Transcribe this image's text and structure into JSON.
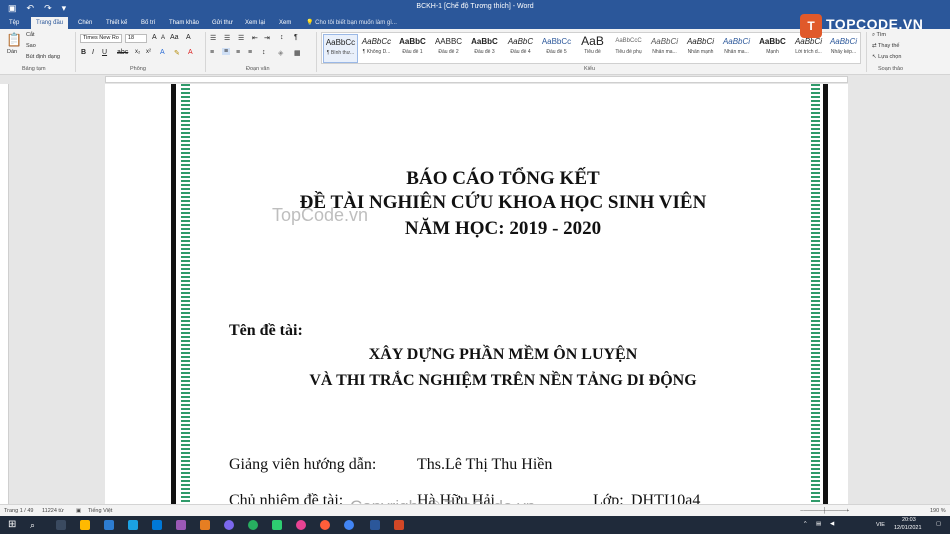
{
  "window": {
    "title": "BCKH-1 [Chế độ Tương thích] - Word"
  },
  "qat": {
    "undo": "↶",
    "redo": "↷",
    "customize": "▾"
  },
  "tabs": [
    {
      "label": "Tệp"
    },
    {
      "label": "Trang đầu"
    },
    {
      "label": "Chèn"
    },
    {
      "label": "Thiết kế"
    },
    {
      "label": "Bố trí"
    },
    {
      "label": "Tham khảo"
    },
    {
      "label": "Gửi thư"
    },
    {
      "label": "Xem lại"
    },
    {
      "label": "Xem"
    }
  ],
  "tell_me": "Cho tôi biết bạn muốn làm gì...",
  "ribbon": {
    "clipboard": {
      "paste": "Dán",
      "cut": "Cắt",
      "copy": "Sao",
      "format_painter": "Bút định dạng",
      "label": "Bảng tạm"
    },
    "font": {
      "name": "Times New Ro",
      "size": "18",
      "label": "Phông"
    },
    "paragraph": {
      "label": "Đoạn văn"
    },
    "styles_label": "Kiểu",
    "editing": {
      "find": "Tìm",
      "replace": "Thay thế",
      "select": "Lựa chọn",
      "label": "Soạn thảo"
    }
  },
  "styles": [
    {
      "preview": "AaBbCc",
      "name": "¶ Bình thư..."
    },
    {
      "preview": "AaBbCc",
      "name": "¶ Không D..."
    },
    {
      "preview": "AaBbC",
      "name": "Đầu đề 1"
    },
    {
      "preview": "AABBC",
      "name": "Đầu đề 2"
    },
    {
      "preview": "AaBbC",
      "name": "Đầu đề 3"
    },
    {
      "preview": "AaBbC",
      "name": "Đầu đề 4"
    },
    {
      "preview": "AaBbCc",
      "name": "Đầu đề 5"
    },
    {
      "preview": "AaB",
      "name": "Tiêu đề"
    },
    {
      "preview": "AaBbCcC",
      "name": "Tiêu đề phụ"
    },
    {
      "preview": "AaBbCi",
      "name": "Nhấn ma..."
    },
    {
      "preview": "AaBbCi",
      "name": "Nhấn mạnh"
    },
    {
      "preview": "AaBbCi",
      "name": "Nhấn ma..."
    },
    {
      "preview": "AaBbC",
      "name": "Mạnh"
    },
    {
      "preview": "AaBbCi",
      "name": "Lời trích d..."
    },
    {
      "preview": "AaBbCi",
      "name": "Nhấy kép..."
    }
  ],
  "document": {
    "title1": "BÁO CÁO TỔNG KẾT",
    "title2": "ĐỀ TÀI NGHIÊN CỨU KHOA HỌC SINH VIÊN",
    "title3": "NĂM HỌC: 2019 - 2020",
    "topic_label": "Tên đề tài:",
    "topic1": "XÂY DỰNG PHẦN MỀM ÔN LUYỆN",
    "topic2": "VÀ THI TRẮC NGHIỆM TRÊN NỀN TẢNG DI ĐỘNG",
    "advisor_label": "Giảng viên hướng dẫn:",
    "advisor": "Ths.Lê Thị Thu Hiền",
    "leader_label": "Chủ nhiệm đề tài:",
    "leader": "Hà Hữu Hải",
    "class_label": "Lớp:",
    "class": "DHTI10a4"
  },
  "watermark": {
    "mid": "TopCode.vn",
    "bottom": "Copyright © TopCode.vn"
  },
  "brand": {
    "logo": "T",
    "name": "TOPCODE.VN"
  },
  "status": {
    "page": "Trang 1 / 49",
    "words": "11224 từ",
    "lang": "Tiếng Việt",
    "zoom": "190 %"
  },
  "taskbar": {
    "lang": "VIE",
    "time": "20:03",
    "date": "12/01/2021"
  }
}
